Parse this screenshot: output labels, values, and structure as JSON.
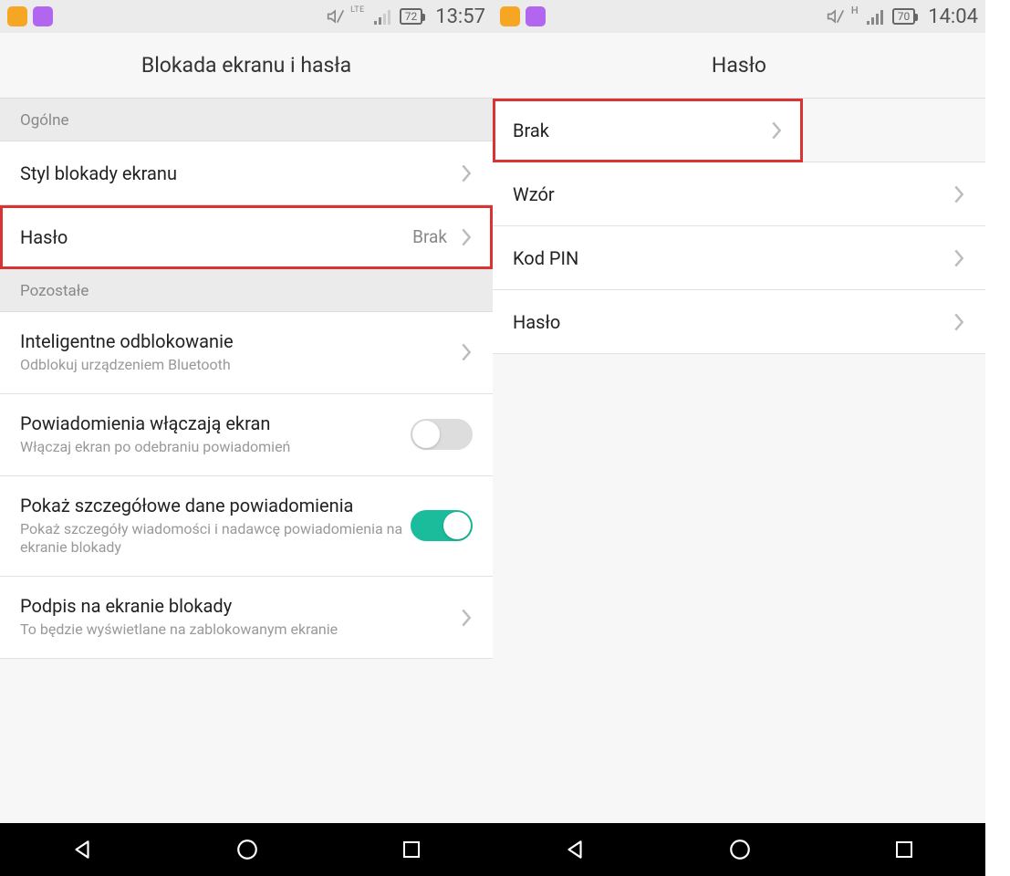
{
  "left": {
    "status": {
      "network": "LTE",
      "battery": "72",
      "time": "13:57"
    },
    "header": {
      "title": "Blokada ekranu i hasła"
    },
    "section1": {
      "label": "Ogólne"
    },
    "row_style": {
      "title": "Styl blokady ekranu"
    },
    "row_password": {
      "title": "Hasło",
      "value": "Brak"
    },
    "section2": {
      "label": "Pozostałe"
    },
    "row_smart": {
      "title": "Inteligentne odblokowanie",
      "sub": "Odblokuj urządzeniem Bluetooth"
    },
    "row_notif_screen": {
      "title": "Powiadomienia włączają ekran",
      "sub": "Włączaj ekran po odebraniu powiadomień"
    },
    "row_notif_detail": {
      "title": "Pokaż szczegółowe dane powiadomienia",
      "sub": "Pokaż szczegóły wiadomości i nadawcę powiadomienia na ekranie blokady"
    },
    "row_signature": {
      "title": "Podpis na ekranie blokady",
      "sub": "To będzie wyświetlane na zablokowanym ekranie"
    }
  },
  "right": {
    "status": {
      "network": "H",
      "battery": "70",
      "time": "14:04"
    },
    "header": {
      "title": "Hasło"
    },
    "row_none": {
      "title": "Brak"
    },
    "row_pattern": {
      "title": "Wzór"
    },
    "row_pin": {
      "title": "Kod PIN"
    },
    "row_password": {
      "title": "Hasło"
    }
  }
}
